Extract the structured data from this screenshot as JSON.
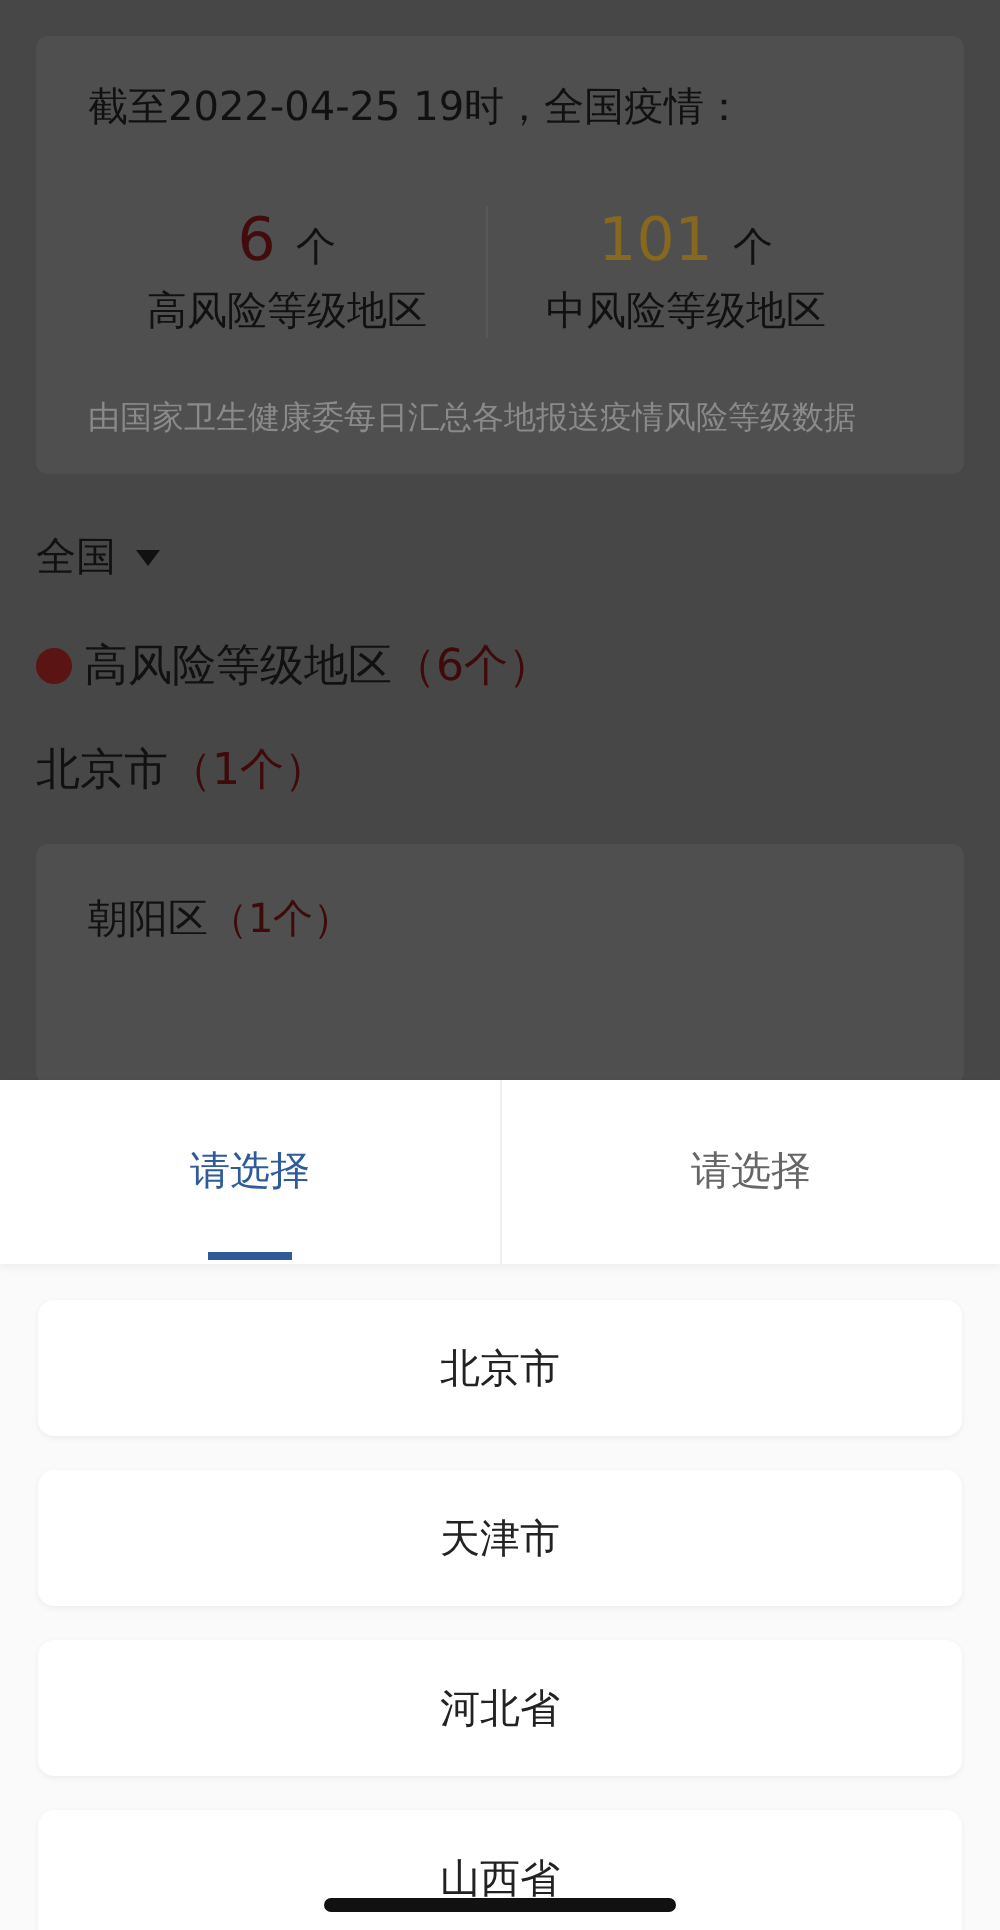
{
  "summary": {
    "heading": "截至2022-04-25 19时，全国疫情：",
    "stats": [
      {
        "value": "6",
        "unit": "个",
        "label": "高风险等级地区",
        "color": "#420c0c"
      },
      {
        "value": "101",
        "unit": "个",
        "label": "中风险等级地区",
        "color": "#86681e"
      }
    ],
    "note": "由国家卫生健康委每日汇总各地报送疫情风险等级数据"
  },
  "region_filter": {
    "value": "全国"
  },
  "risk_group": {
    "label": "高风险等级地区",
    "count": "（6个）",
    "color": "#5a1414"
  },
  "city": {
    "name": "北京市",
    "count": "（1个）"
  },
  "districts": [
    {
      "name": "朝阳区",
      "count": "（1个）"
    }
  ],
  "picker": {
    "tabs": [
      {
        "label": "请选择",
        "selected": true
      },
      {
        "label": "请选择",
        "selected": false
      }
    ],
    "options": [
      {
        "label": "北京市"
      },
      {
        "label": "天津市"
      },
      {
        "label": "河北省"
      },
      {
        "label": "山西省"
      }
    ]
  }
}
